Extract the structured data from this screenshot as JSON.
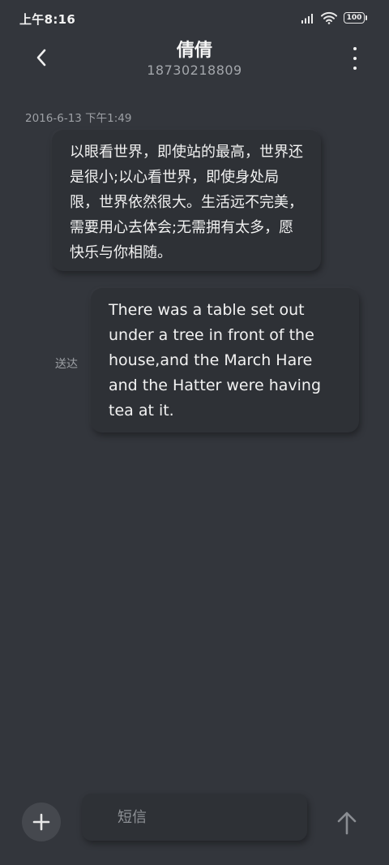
{
  "status_bar": {
    "time": "上午8:16",
    "battery": "100"
  },
  "header": {
    "title": "倩倩",
    "phone": "18730218809"
  },
  "messages": [
    {
      "direction": "incoming",
      "timestamp": "2016-6-13 下午1:49",
      "text": "以眼看世界，即使站的最高，世界还是很小;以心看世界，即使身处局限，世界依然很大。生活远不完美，需要用心去体会;无需拥有太多，愿快乐与你相随。"
    },
    {
      "direction": "outgoing",
      "status": "送达",
      "text": "There was a table set out under a tree in front of the house,and the March Hare and the Hatter were having tea at it."
    }
  ],
  "composer": {
    "placeholder": "短信"
  },
  "icons": {
    "back": "chevron-left-icon",
    "more": "more-vertical-icon",
    "add": "plus-icon",
    "send": "arrow-up-icon",
    "signal": "signal-icon",
    "wifi": "wifi-icon",
    "battery": "battery-icon"
  },
  "colors": {
    "background": "#33363c",
    "bubble": "#2e3136",
    "primary_text": "#f2f2f2",
    "secondary_text": "#9da0a5"
  }
}
